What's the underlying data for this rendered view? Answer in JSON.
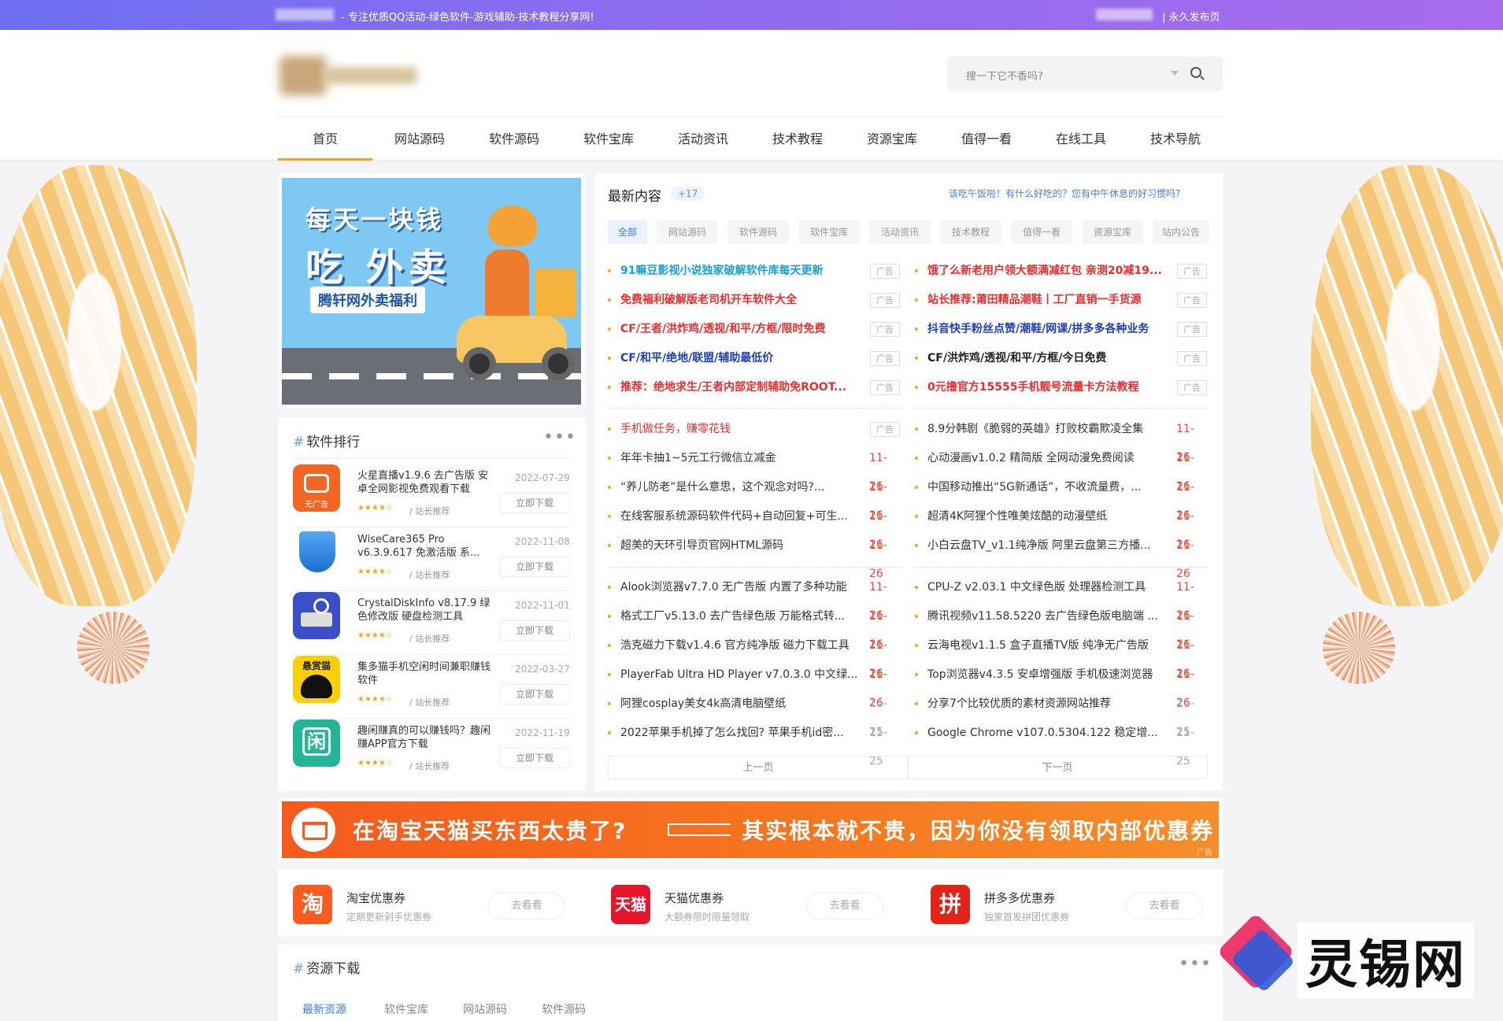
{
  "topbar": {
    "slogan": "- 专注优质QQ活动-绿色软件-游戏辅助-技术教程分享网!",
    "publish": "| 永久发布页"
  },
  "search": {
    "placeholder": "搜一下它不香吗?"
  },
  "nav": {
    "items": [
      "首页",
      "网站源码",
      "软件源码",
      "软件宝库",
      "活动资讯",
      "技术教程",
      "资源宝库",
      "值得一看",
      "在线工具",
      "技术导航"
    ]
  },
  "food_banner": {
    "line1": "每天一块钱",
    "line2": "吃 外卖",
    "tag": "腾轩网外卖福利"
  },
  "ranking": {
    "title": "软件排行",
    "items": [
      {
        "name": "火星直播v1.9.6 去广告版 安卓全网影视免费观看下载",
        "date": "2022-07-29",
        "stars": "★★★★☆",
        "rec": "/ 站长推荐",
        "btn": "立即下载",
        "icon_text": "无广告"
      },
      {
        "name": "WiseCare365 Pro v6.3.9.617 免激活版 系...",
        "date": "2022-11-08",
        "stars": "★★★★☆",
        "rec": "/ 站长推荐",
        "btn": "立即下载",
        "icon_text": ""
      },
      {
        "name": "CrystalDiskInfo v8.17.9 绿色修改版 硬盘检测工具",
        "date": "2022-11-01",
        "stars": "★★★★☆",
        "rec": "/ 站长推荐",
        "btn": "立即下载",
        "icon_text": ""
      },
      {
        "name": "集多猫手机空闲时间兼职赚钱软件",
        "date": "2022-03-27",
        "stars": "★★★★☆",
        "rec": "/ 站长推荐",
        "btn": "立即下载",
        "icon_text": "悬赏猫"
      },
      {
        "name": "趣闲赚真的可以赚钱吗？趣闲赚APP官方下载",
        "date": "2022-11-19",
        "stars": "★★★★☆",
        "rec": "/ 站长推荐",
        "btn": "立即下载",
        "icon_text": "闲"
      }
    ]
  },
  "latest": {
    "title": "最新内容",
    "badge": "+17",
    "head_link": "该吃午饭啦！有什么好吃的？您有中午休息的好习惯吗?",
    "tabs": [
      "全部",
      "网站源码",
      "软件源码",
      "软件宝库",
      "活动资讯",
      "技术教程",
      "值得一看",
      "资源宝库",
      "站内公告"
    ],
    "ad_label": "广告",
    "left_ads": [
      {
        "text": "91嘛豆影视小说独家破解软件库每天更新",
        "color": "#1a9ed9"
      },
      {
        "text": "免费福利破解版老司机开车软件大全",
        "color": "#e62e2e"
      },
      {
        "text": "CF/王者/洪炸鸡/透视/和平/方框/限时免费",
        "color": "#e62e2e"
      },
      {
        "text": "CF/和平/绝地/联盟/辅助最低价",
        "color": "#1e3fb8"
      },
      {
        "text": "推荐：绝地求生/王者内部定制辅助免ROOT...",
        "color": "#e62e2e"
      }
    ],
    "right_ads": [
      {
        "text": "饿了么新老用户领大额满减红包 亲测20减19...",
        "color": "#e62e2e"
      },
      {
        "text": "站长推荐:莆田精品潮鞋丨工厂直销一手货源",
        "color": "#e62e2e"
      },
      {
        "text": "抖音快手粉丝点赞/潮鞋/网课/拼多多各种业务",
        "color": "#1e3fb8"
      },
      {
        "text": "CF/洪炸鸡/透视/和平/方框/今日免费",
        "color": "#222222"
      },
      {
        "text": "0元撸官方15555手机靓号流量卡方法教程",
        "color": "#e62e2e"
      }
    ],
    "left_group2": [
      {
        "text": "手机做任务，赚零花钱",
        "date": "",
        "ad": true,
        "color": "#e62e2e"
      },
      {
        "text": "年年卡抽1~5元工行微信立减金",
        "date": "11-26",
        "ad": false,
        "color": "#333333"
      },
      {
        "text": "“养儿防老”是什么意思，这个观念对吗?...",
        "date": "11-26",
        "ad": false,
        "color": "#333333"
      },
      {
        "text": "在线客服系统源码软件代码+自动回复+可生...",
        "date": "11-26",
        "ad": false,
        "color": "#333333"
      },
      {
        "text": "超美的天环引导页官网HTML源码",
        "date": "11-26",
        "ad": false,
        "color": "#333333"
      }
    ],
    "right_group2": [
      {
        "text": "8.9分韩剧《脆弱的英雄》打败校霸欺凌全集",
        "date": "11-26",
        "color": "#333333"
      },
      {
        "text": "心动漫画v1.0.2 精简版 全网动漫免费阅读",
        "date": "11-26",
        "color": "#333333"
      },
      {
        "text": "中国移动推出“5G新通话”，不收流量费，...",
        "date": "11-26",
        "color": "#333333"
      },
      {
        "text": "超清4K阿狸个性唯美炫酷的动漫壁纸",
        "date": "11-26",
        "color": "#333333"
      },
      {
        "text": "小白云盘TV_v1.1纯净版 阿里云盘第三方播...",
        "date": "11-26",
        "color": "#333333"
      }
    ],
    "left_group3": [
      {
        "text": "Alook浏览器v7.7.0 无广告版 内置了多种功能",
        "date": "11-26",
        "grey": false
      },
      {
        "text": "格式工厂v5.13.0 去广告绿色版 万能格式转...",
        "date": "11-26",
        "grey": false
      },
      {
        "text": "浩克磁力下载v1.4.6 官方纯净版 磁力下载工具",
        "date": "11-26",
        "grey": false
      },
      {
        "text": "PlayerFab Ultra HD Player v7.0.3.0 中文绿...",
        "date": "11-26",
        "grey": false
      },
      {
        "text": "阿狸cosplay美女4k高清电脑壁纸",
        "date": "11-25",
        "grey": true
      },
      {
        "text": "2022苹果手机掉了怎么找回? 苹果手机id密...",
        "date": "11-25",
        "grey": true
      }
    ],
    "right_group3": [
      {
        "text": "CPU-Z v2.03.1 中文绿色版 处理器检测工具",
        "date": "11-26",
        "grey": false
      },
      {
        "text": "腾讯视频v11.58.5220 去广告绿色版电脑端 ...",
        "date": "11-26",
        "grey": false
      },
      {
        "text": "云海电视v1.1.5 盒子直播TV版 纯净无广告版",
        "date": "11-26",
        "grey": false
      },
      {
        "text": "Top浏览器v4.3.5 安卓增强版 手机极速浏览器",
        "date": "11-26",
        "grey": false
      },
      {
        "text": "分享7个比较优质的素材资源网站推荐",
        "date": "11-25",
        "grey": true
      },
      {
        "text": "Google Chrome v107.0.5304.122 稳定增...",
        "date": "11-25",
        "grey": true
      }
    ],
    "prev": "上一页",
    "next": "下一页"
  },
  "taobao_banner": {
    "text1": "在淘宝天猫买东西太贵了?",
    "text2": "其实根本就不贵，因为你没有领取内部优惠券",
    "ad": "广告"
  },
  "coupons": [
    {
      "icon": "淘",
      "name": "淘宝优惠券",
      "desc": "定期更新剁手优惠券",
      "btn": "去看看",
      "color": "#ff5a1f"
    },
    {
      "icon": "天猫",
      "name": "天猫优惠券",
      "desc": "大额券限时限量领取",
      "btn": "去看看",
      "color": "#e5162c"
    },
    {
      "icon": "拼",
      "name": "拼多多优惠券",
      "desc": "独家首发拼团优惠券",
      "btn": "去看看",
      "color": "#e2231a"
    }
  ],
  "downloads": {
    "title": "资源下载",
    "tabs": [
      "最新资源",
      "软件宝库",
      "网站源码",
      "软件源码"
    ]
  },
  "watermark": {
    "text": "灵锡网"
  }
}
